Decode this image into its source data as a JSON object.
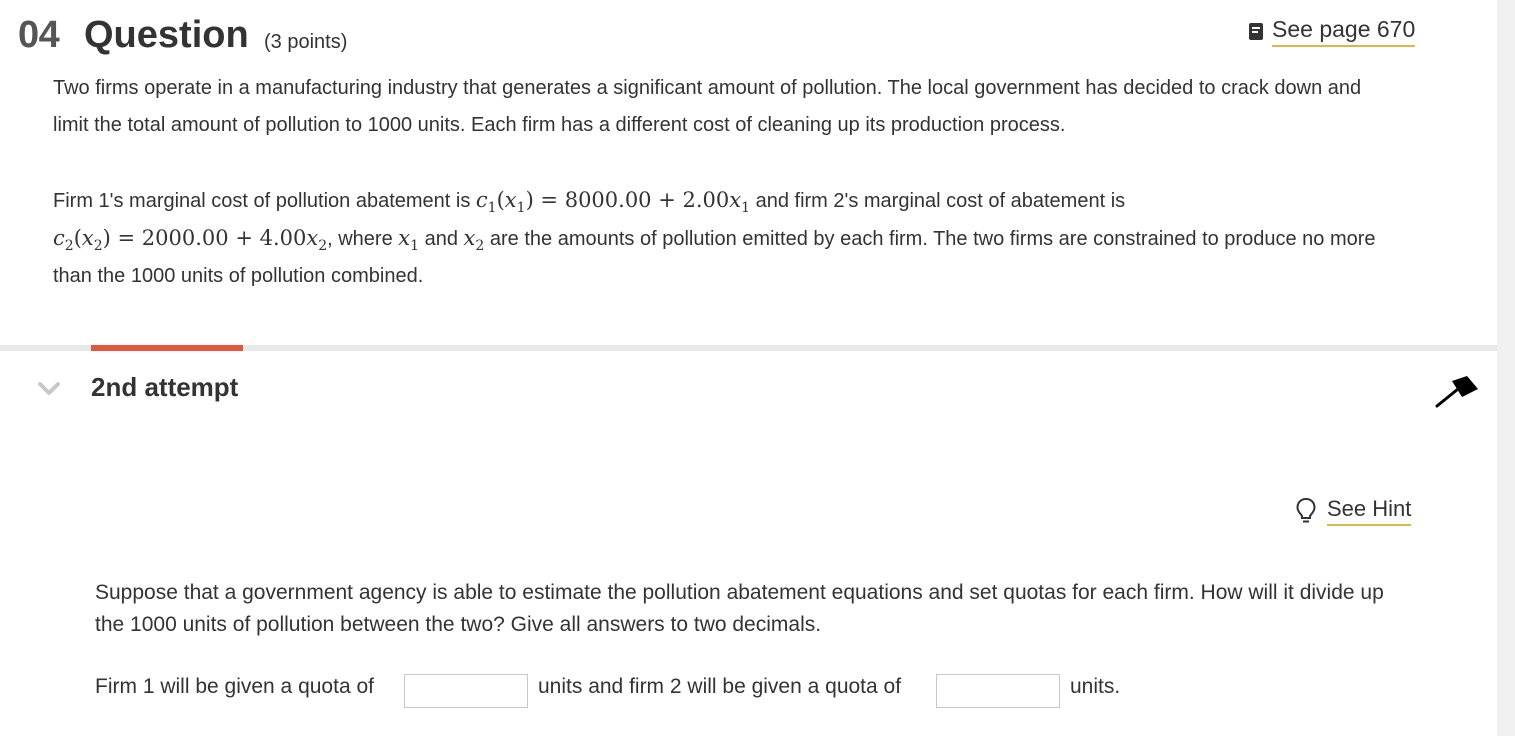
{
  "header": {
    "number": "04",
    "title": "Question",
    "points": "(3 points)",
    "see_page_label": "See page 670"
  },
  "problem": {
    "para1_line1": "Two firms operate in a manufacturing industry that generates a significant amount of pollution. The local government has decided to crack down and",
    "para1_line2": "limit the total amount of pollution to 1000 units. Each firm has a different cost of cleaning up its production process.",
    "para2_pre": "Firm 1's marginal cost of pollution abatement is",
    "para2_mid": "and firm 2's marginal cost of abatement is",
    "para2_where": ", where",
    "para2_and": "and",
    "para2_rest": "are the amounts of pollution emitted by each firm. The two firms are constrained to produce no more",
    "para2_line3": "than the 1000 units of pollution combined.",
    "eq1_const": "8000.00",
    "eq1_coef": "2.00",
    "eq2_const": "2000.00",
    "eq2_coef": "4.00"
  },
  "attempt": {
    "label": "2nd attempt"
  },
  "hint": {
    "label": "See Hint"
  },
  "question": {
    "text": "Suppose that a government agency is able to estimate the pollution abatement equations and set quotas for each firm. How will it divide up the 1000 units of pollution between the two? Give all answers to two decimals.",
    "answer_pre": "Firm 1 will be given a quota of",
    "answer_mid": "units and firm 2 will be given a quota of",
    "answer_post": "units.",
    "firm1_value": "",
    "firm2_value": ""
  },
  "colors": {
    "accent_underline": "#e0b64a",
    "attempt_accent": "#e2583e",
    "text": "#333333"
  },
  "icons": {
    "see_page": "book-icon",
    "collapse": "chevron-down-icon",
    "pin": "pin-icon",
    "hint": "lightbulb-icon"
  }
}
